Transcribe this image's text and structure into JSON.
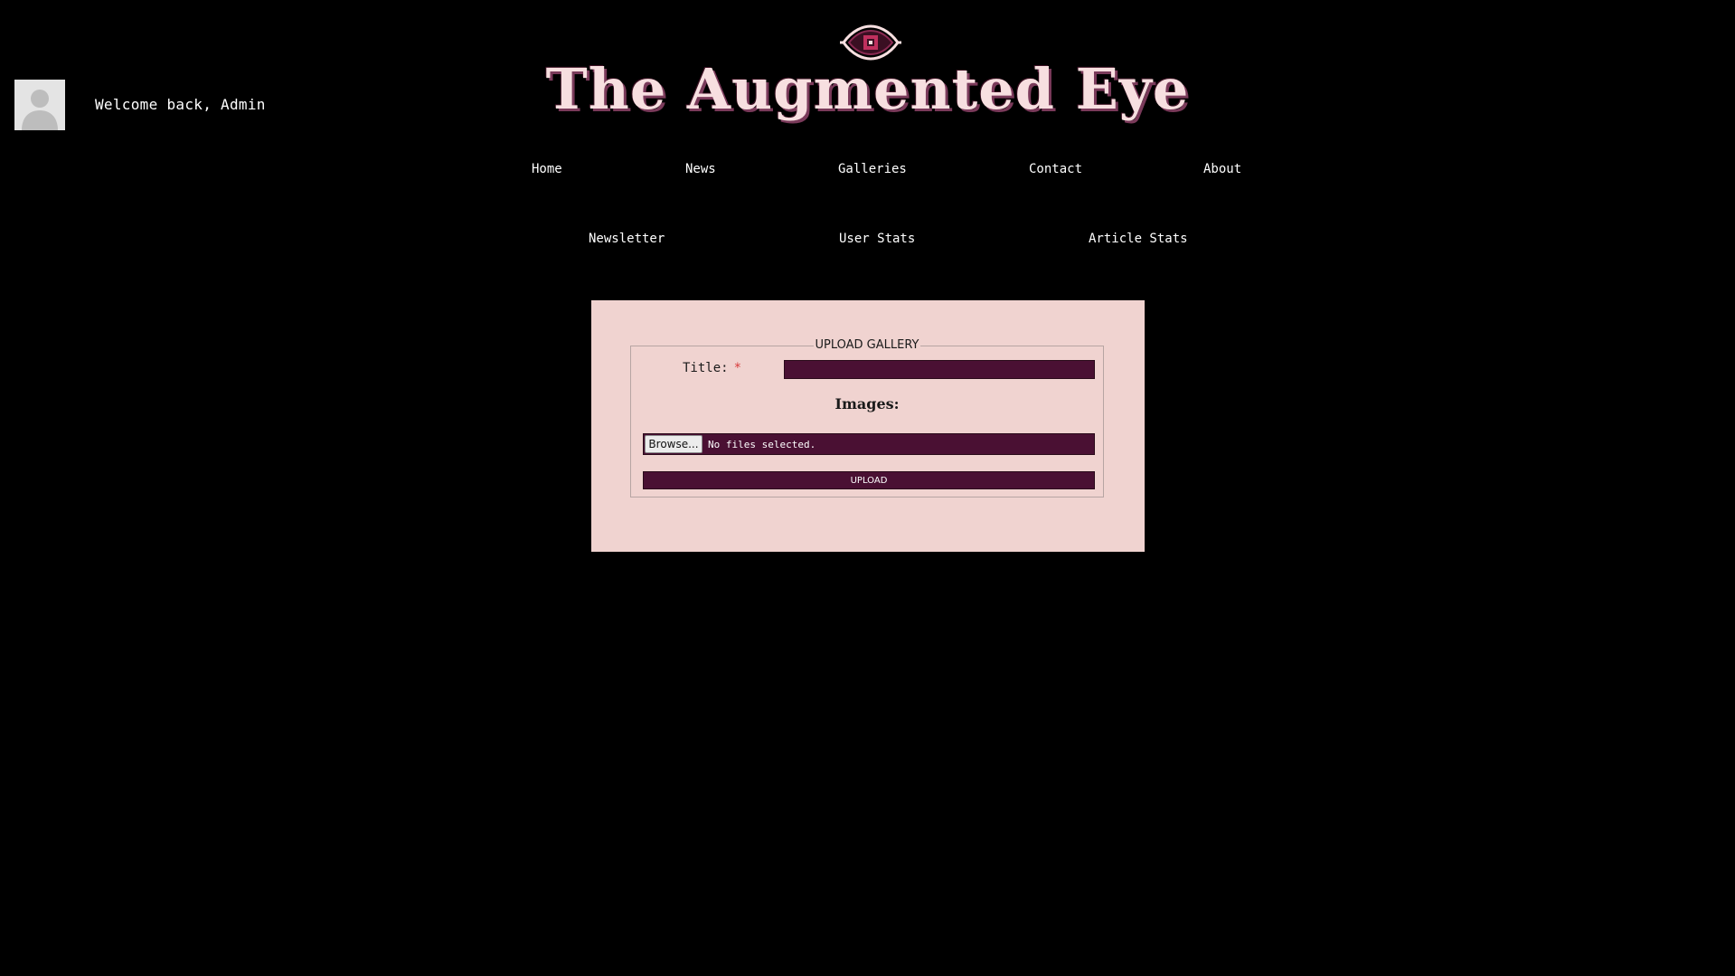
{
  "user": {
    "welcome_text": "Welcome back, Admin",
    "avatar_icon": "user-silhouette-icon"
  },
  "header": {
    "site_title": "The Augmented Eye",
    "logo_icon": "eye-icon"
  },
  "nav": {
    "primary": [
      {
        "label": "Home"
      },
      {
        "label": "News"
      },
      {
        "label": "Galleries"
      },
      {
        "label": "Contact"
      },
      {
        "label": "About"
      }
    ],
    "admin": [
      {
        "label": "Newsletter"
      },
      {
        "label": "User Stats"
      },
      {
        "label": "Article Stats"
      }
    ]
  },
  "form": {
    "legend": "UPLOAD GALLERY",
    "title_label": "Title:",
    "required_marker": "*",
    "title_value": "",
    "images_label": "Images:",
    "browse_label": "Browse...",
    "file_status": "No files selected.",
    "submit_label": "UPLOAD"
  },
  "colors": {
    "background": "#000000",
    "panel": "#f0d3d0",
    "input_fill": "#4a1033",
    "title_text": "#f7dfe0",
    "required": "#d83a3a"
  }
}
